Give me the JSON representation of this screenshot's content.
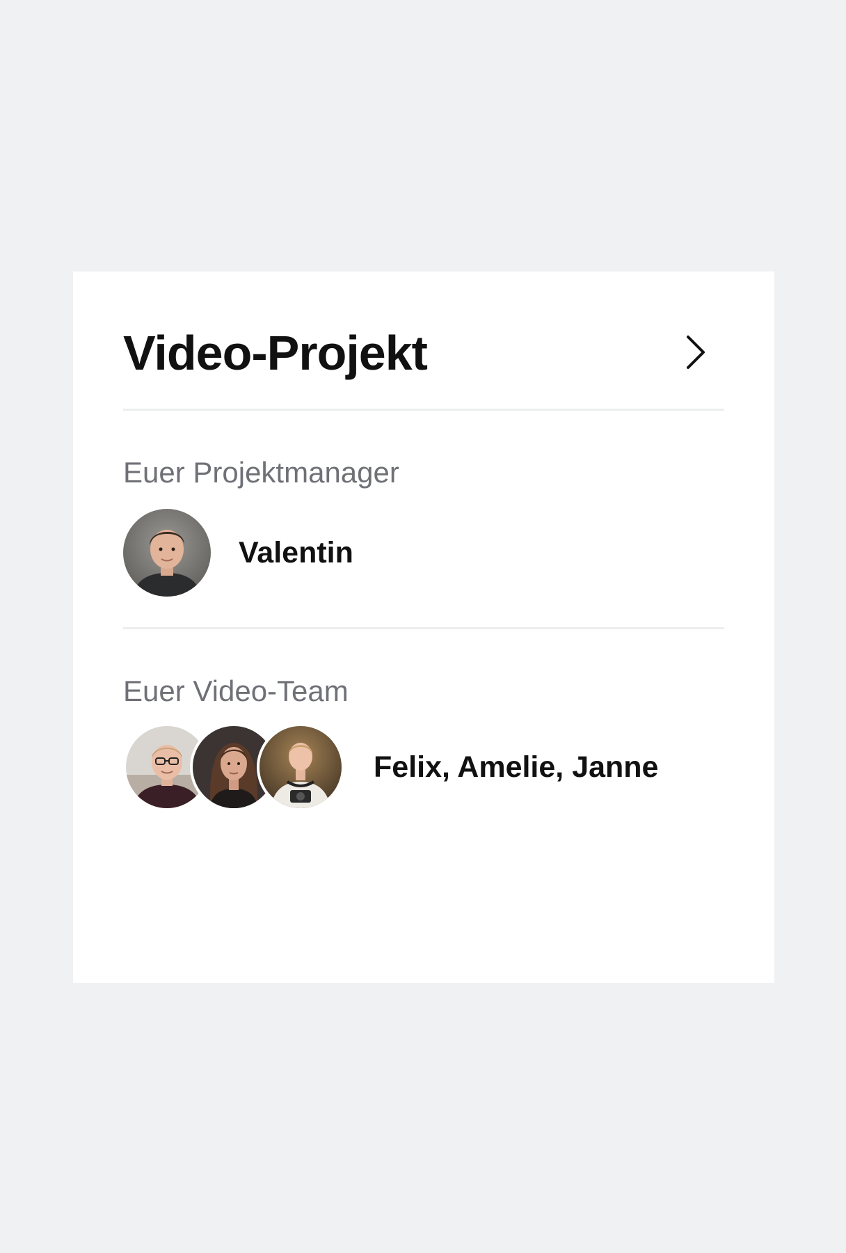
{
  "card": {
    "title": "Video-Projekt",
    "open_icon": "chevron-right-icon"
  },
  "project_manager": {
    "label": "Euer Projektmanager",
    "name": "Valentin",
    "avatar_icon": "user-avatar"
  },
  "video_team": {
    "label": "Euer Video-Team",
    "names": "Felix, Amelie, Janne",
    "avatar_icons": [
      "user-avatar",
      "user-avatar",
      "user-avatar"
    ]
  }
}
